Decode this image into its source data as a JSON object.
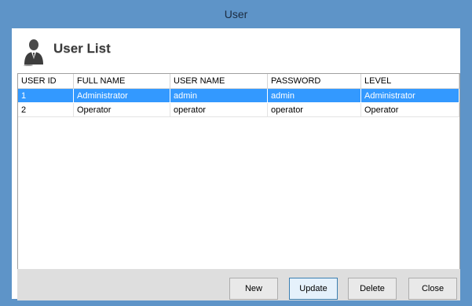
{
  "window": {
    "title": "User"
  },
  "header": {
    "title": "User List",
    "icon": "user-icon"
  },
  "table": {
    "columns": [
      "USER ID",
      "FULL NAME",
      "USER NAME",
      "PASSWORD",
      "LEVEL"
    ],
    "rows": [
      {
        "selected": true,
        "cells": [
          "1",
          "Administrator",
          "admin",
          "admin",
          "Administrator"
        ]
      },
      {
        "selected": false,
        "cells": [
          "2",
          "Operator",
          "operator",
          "operator",
          "Operator"
        ]
      }
    ]
  },
  "buttons": {
    "new": "New",
    "update": "Update",
    "delete": "Delete",
    "close": "Close"
  },
  "colors": {
    "titlebar": "#5e94c8",
    "selection": "#3399ff",
    "panel": "#dedede"
  }
}
